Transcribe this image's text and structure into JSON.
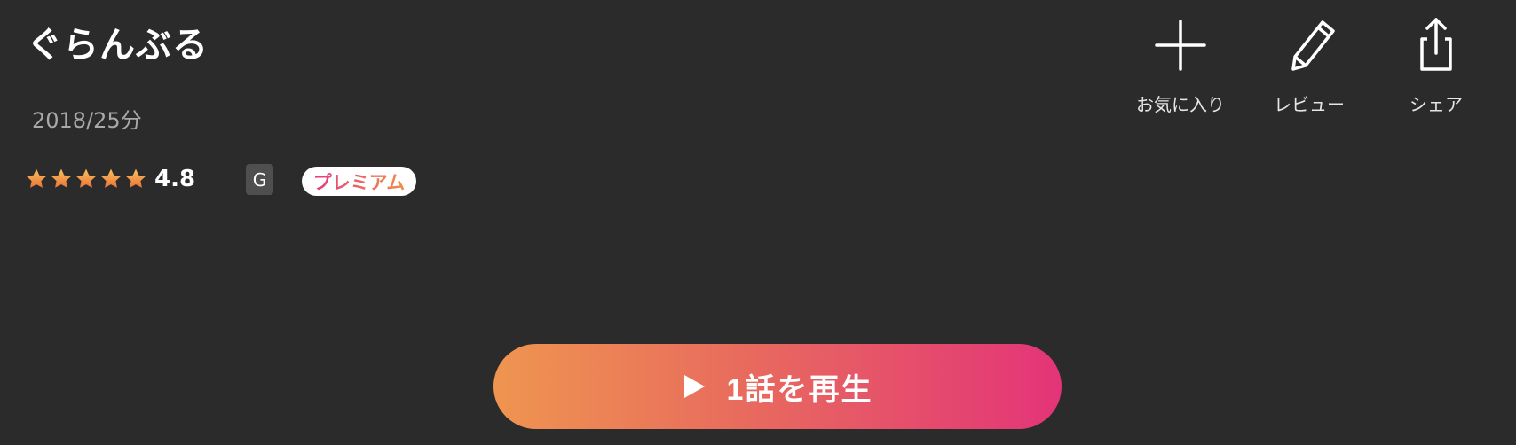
{
  "title": "ぐらんぶる",
  "meta": "2018/25分",
  "rating": {
    "stars": 5,
    "value": "4.8",
    "star_color_top": "#f6b04a",
    "star_color_bottom": "#e9793a"
  },
  "age_rating": "G",
  "premium_label": "プレミアム",
  "actions": {
    "favorite_label": "お気に入り",
    "review_label": "レビュー",
    "share_label": "シェア"
  },
  "play_button": {
    "label": "1話を再生",
    "gradient_start": "#ef9550",
    "gradient_end": "#e33478"
  },
  "icons": [
    "plus-icon",
    "pencil-icon",
    "share-icon",
    "play-icon",
    "star-icon"
  ],
  "colors": {
    "background": "#2b2b2b",
    "meta_text": "#a9a9a9",
    "premium_gradient_start": "#e53b7d",
    "premium_gradient_end": "#f08d4a"
  }
}
